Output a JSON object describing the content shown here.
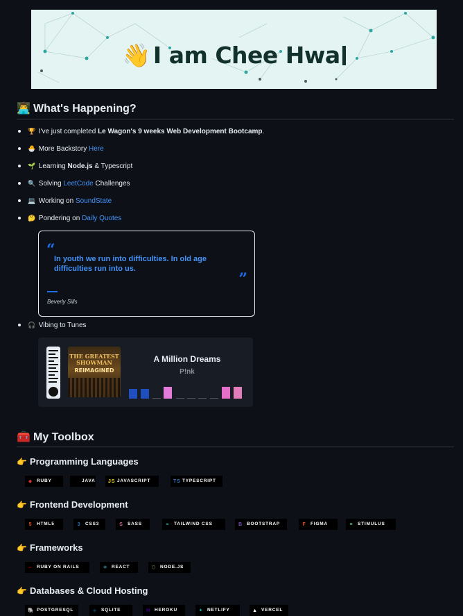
{
  "banner": {
    "wave_emoji": "👋",
    "title": "I am Chee Hwa"
  },
  "happening": {
    "emoji": "👨‍💻",
    "title": "What's Happening?",
    "items": [
      {
        "emoji": "🏆",
        "pre": "I've just completed ",
        "bold": "Le Wagon's 9 weeks Web Development Bootcamp",
        "post": ".",
        "link": ""
      },
      {
        "emoji": "🐣",
        "pre": "More Backstory ",
        "bold": "",
        "post": "",
        "link": "Here"
      },
      {
        "emoji": "🌱",
        "pre": "Learning ",
        "bold": "Node.js",
        "post": " & Typescript",
        "link": ""
      },
      {
        "emoji": "🔍",
        "pre": "Solving ",
        "bold": "",
        "post": " Challenges",
        "link": "LeetCode"
      },
      {
        "emoji": "💻",
        "pre": "Working on ",
        "bold": "",
        "post": "",
        "link": "SoundState"
      },
      {
        "emoji": "🤔",
        "pre": "Pondering on ",
        "bold": "",
        "post": "",
        "link": "Daily Quotes"
      }
    ],
    "tunes_item": {
      "emoji": "🎧",
      "text": "Vibing to Tunes"
    }
  },
  "quote_card": {
    "open_mark": "“",
    "close_mark": "”",
    "text": "In youth we run into difficulties. In old age difficulties run into us.",
    "author": "Beverly Sills"
  },
  "spotify_card": {
    "album_line1": "THE GREATEST SHOWMAN",
    "album_line2": "REIMAGINED",
    "song": "A Million Dreams",
    "artist": "P!nk"
  },
  "toolbox": {
    "emoji": "🧰",
    "title": "My Toolbox",
    "sections": [
      {
        "emoji": "👉",
        "title": "Programming Languages",
        "badges": [
          {
            "label": "RUBY",
            "icon": "◆",
            "color": "#cc342d"
          },
          {
            "label": "JAVA",
            "icon": "",
            "color": "#ffffff"
          },
          {
            "label": "JAVASCRIPT",
            "icon": "JS",
            "color": "#f7df1e"
          },
          {
            "label": "TYPESCRIPT",
            "icon": "TS",
            "color": "#3178c6"
          }
        ]
      },
      {
        "emoji": "👉",
        "title": "Frontend Development",
        "badges": [
          {
            "label": "HTML5",
            "icon": "5",
            "color": "#e34f26"
          },
          {
            "label": "CSS3",
            "icon": "3",
            "color": "#1572b6"
          },
          {
            "label": "SASS",
            "icon": "S",
            "color": "#cc6699"
          },
          {
            "label": "TAILWIND CSS",
            "icon": "≈",
            "color": "#38b2ac"
          },
          {
            "label": "BOOTSTRAP",
            "icon": "B",
            "color": "#7952b3"
          },
          {
            "label": "FIGMA",
            "icon": "F",
            "color": "#f24e1e"
          },
          {
            "label": "STIMULUS",
            "icon": "≡",
            "color": "#77e8b9"
          }
        ]
      },
      {
        "emoji": "👉",
        "title": "Frameworks",
        "badges": [
          {
            "label": "RUBY ON RAILS",
            "icon": "∽",
            "color": "#cc0000"
          },
          {
            "label": "REACT",
            "icon": "⚛",
            "color": "#61dafb"
          },
          {
            "label": "NODE.JS",
            "icon": "⬡",
            "color": "#6da55f"
          }
        ]
      },
      {
        "emoji": "👉",
        "title": "Databases & Cloud Hosting",
        "badges": [
          {
            "label": "POSTGRESQL",
            "icon": "🐘",
            "color": "#316192"
          },
          {
            "label": "SQLITE",
            "icon": "◈",
            "color": "#07405e"
          },
          {
            "label": "HEROKU",
            "icon": "H",
            "color": "#430098"
          },
          {
            "label": "NETLIFY",
            "icon": "✦",
            "color": "#00c7b7"
          },
          {
            "label": "VERCEL",
            "icon": "▲",
            "color": "#ffffff"
          }
        ]
      }
    ]
  }
}
